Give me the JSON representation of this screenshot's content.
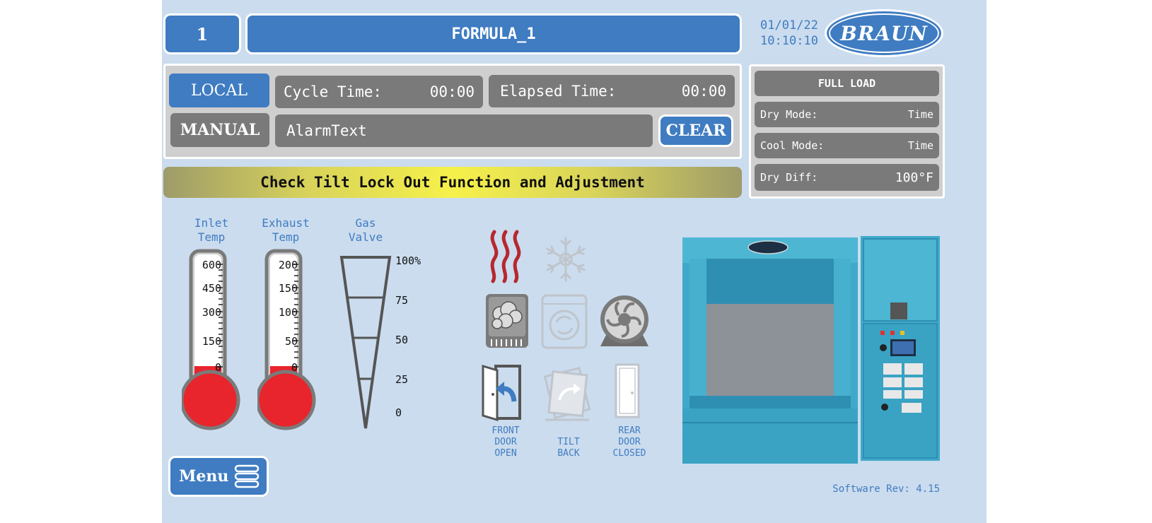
{
  "header": {
    "station_number": "1",
    "formula_name": "FORMULA_1",
    "date": "01/01/22",
    "time": "10:10:10",
    "logo_text": "BRAUN"
  },
  "status": {
    "mode_local": "LOCAL",
    "mode_manual": "MANUAL",
    "cycle_time_label": "Cycle Time:",
    "cycle_time_value": "00:00",
    "elapsed_time_label": "Elapsed Time:",
    "elapsed_time_value": "00:00",
    "alarm_text": "AlarmText",
    "clear_label": "CLEAR"
  },
  "load_info": {
    "title": "FULL LOAD",
    "rows": [
      {
        "label": "Dry Mode:",
        "value": "Time"
      },
      {
        "label": "Cool Mode:",
        "value": "Time"
      },
      {
        "label": "Dry Diff:",
        "value": "100°F"
      }
    ]
  },
  "message_banner": "Check Tilt Lock Out Function and Adjustment",
  "gauges": {
    "inlet": {
      "label_line1": "Inlet",
      "label_line2": "Temp",
      "ticks": [
        "600",
        "450",
        "300",
        "150",
        "0"
      ],
      "level_fraction": 0.0
    },
    "exhaust": {
      "label_line1": "Exhaust",
      "label_line2": "Temp",
      "ticks": [
        "200",
        "150",
        "100",
        "50",
        "0"
      ],
      "level_fraction": 0.0
    },
    "gas_valve": {
      "label_line1": "Gas",
      "label_line2": "Valve",
      "ticks": [
        "100%",
        "75",
        "50",
        "25",
        "0"
      ]
    }
  },
  "status_icons": {
    "heat": "heat-icon",
    "cool": "snowflake-icon",
    "dry": "dryer-steam-icon",
    "tumble": "tumble-icon",
    "fan": "fan-icon",
    "front_door_label": [
      "FRONT",
      "DOOR",
      "OPEN"
    ],
    "tilt_label": [
      "TILT",
      "BACK"
    ],
    "rear_door_label": [
      "REAR",
      "DOOR",
      "CLOSED"
    ]
  },
  "menu_label": "Menu",
  "software_rev": "Software Rev: 4.15",
  "colors": {
    "background": "#cbdcee",
    "accent_blue": "#3f7cc2",
    "grey_box": "#7a7a7a",
    "banner_yellow": "#f3ee45",
    "gauge_red": "#e8242c",
    "machine_teal": "#3fa9c9"
  }
}
